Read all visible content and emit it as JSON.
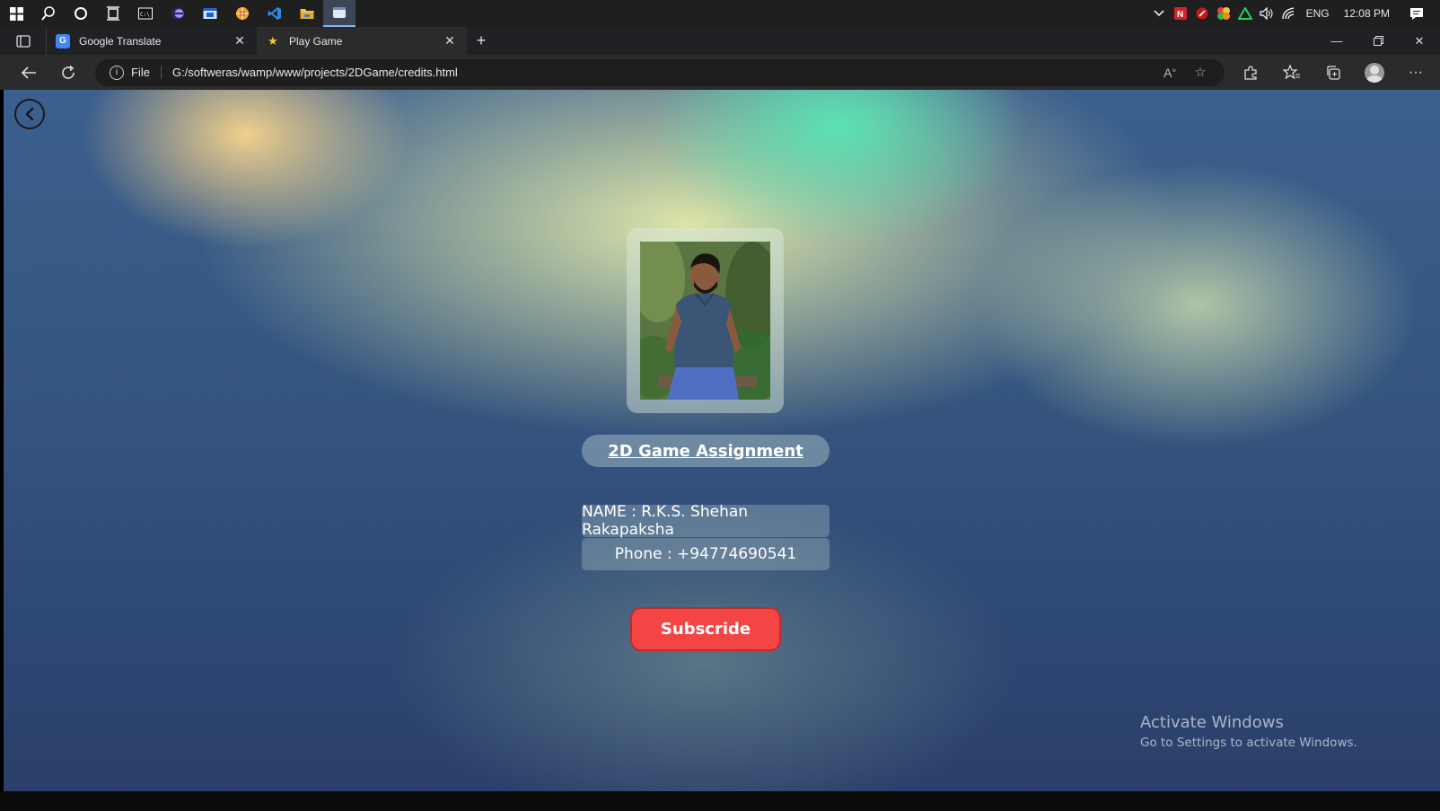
{
  "taskbar": {
    "icons": [
      "windows-start",
      "search",
      "cortana",
      "task-view",
      "terminal",
      "eclipse",
      "app",
      "photoshop-like",
      "vscode",
      "file-explorer",
      "browser-edge"
    ],
    "tray": {
      "language": "ENG",
      "time": "12:08 PM"
    }
  },
  "browser": {
    "tabs": [
      {
        "title": "Google Translate",
        "active": false
      },
      {
        "title": "Play Game",
        "active": true
      }
    ],
    "address": {
      "scheme_label": "File",
      "url": "G:/softweras/wamp/www/projects/2DGame/credits.html"
    }
  },
  "page": {
    "title": "2D Game Assignment",
    "name_line": "NAME : R.K.S. Shehan Rakapaksha",
    "phone_line": "Phone : +94774690541",
    "subscribe_label": "Subscride"
  },
  "watermark": {
    "line1": "Activate Windows",
    "line2": "Go to Settings to activate Windows."
  },
  "colors": {
    "subscribe_bg": "#f44545",
    "taskbar_bg": "#1f1f1f",
    "browser_bg": "#2b2b2b"
  }
}
